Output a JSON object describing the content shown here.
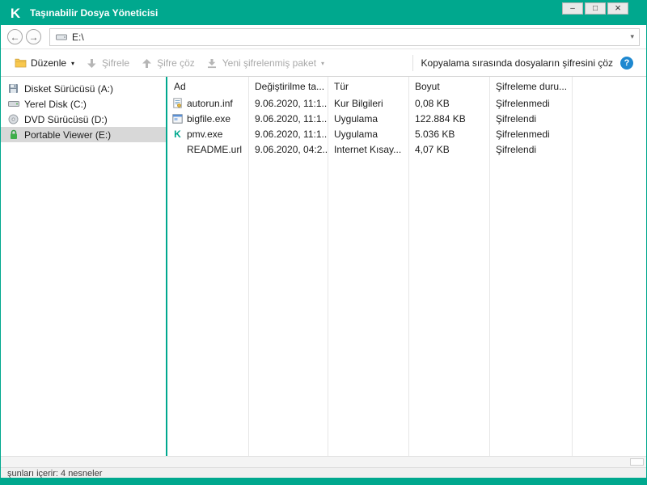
{
  "window": {
    "title": "Taşınabilir Dosya Yöneticisi"
  },
  "icons": {
    "logo": "K",
    "minimize": "–",
    "maximize": "□",
    "close": "×",
    "back": "←",
    "forward": "→",
    "dropdown": "▾",
    "kaspersky_k": "K"
  },
  "navbar": {
    "address": "E:\\"
  },
  "toolbar": {
    "duzenle": "Düzenle",
    "sifrele": "Şifrele",
    "sifre_coz": "Şifre çöz",
    "yeni_paket": "Yeni şifrelenmiş paket",
    "decrypt_on_copy": "Kopyalama sırasında dosyaların şifresini çöz",
    "help": "?"
  },
  "sidebar": {
    "items": [
      {
        "label": "Disket Sürücüsü (A:)",
        "icon": "floppy-icon",
        "selected": false
      },
      {
        "label": "Yerel Disk (C:)",
        "icon": "hdd-icon",
        "selected": false
      },
      {
        "label": "DVD Sürücüsü (D:)",
        "icon": "dvd-icon",
        "selected": false
      },
      {
        "label": "Portable Viewer (E:)",
        "icon": "lock-icon",
        "selected": true
      }
    ]
  },
  "filelist": {
    "columns": [
      "Ad",
      "Değiştirilme ta...",
      "Tür",
      "Boyut",
      "Şifreleme duru..."
    ],
    "rows": [
      {
        "name": "autorun.inf",
        "modified": "9.06.2020, 11:1...",
        "type": "Kur Bilgileri",
        "size": "0,08 KB",
        "status": "Şifrelenmedi",
        "icon": "inf-file-icon"
      },
      {
        "name": "bigfile.exe",
        "modified": "9.06.2020, 11:1...",
        "type": "Uygulama",
        "size": "122.884 KB",
        "status": "Şifrelendi",
        "icon": "exe-file-icon"
      },
      {
        "name": "pmv.exe",
        "modified": "9.06.2020, 11:1...",
        "type": "Uygulama",
        "size": "5.036 KB",
        "status": "Şifrelenmedi",
        "icon": "kaspersky-icon"
      },
      {
        "name": "README.url",
        "modified": "9.06.2020, 04:2...",
        "type": "Internet Kısay...",
        "size": "4,07 KB",
        "status": "Şifrelendi",
        "icon": "url-file-icon"
      }
    ]
  },
  "statusbar": {
    "text": "şunları içerir: 4 nesneler"
  },
  "colors": {
    "accent_teal": "#00a88e",
    "help_blue": "#1e88d0",
    "selected_bg": "#d8d8d8",
    "folder_yellow": "#f9c84d",
    "lock_green": "#3fae49"
  }
}
